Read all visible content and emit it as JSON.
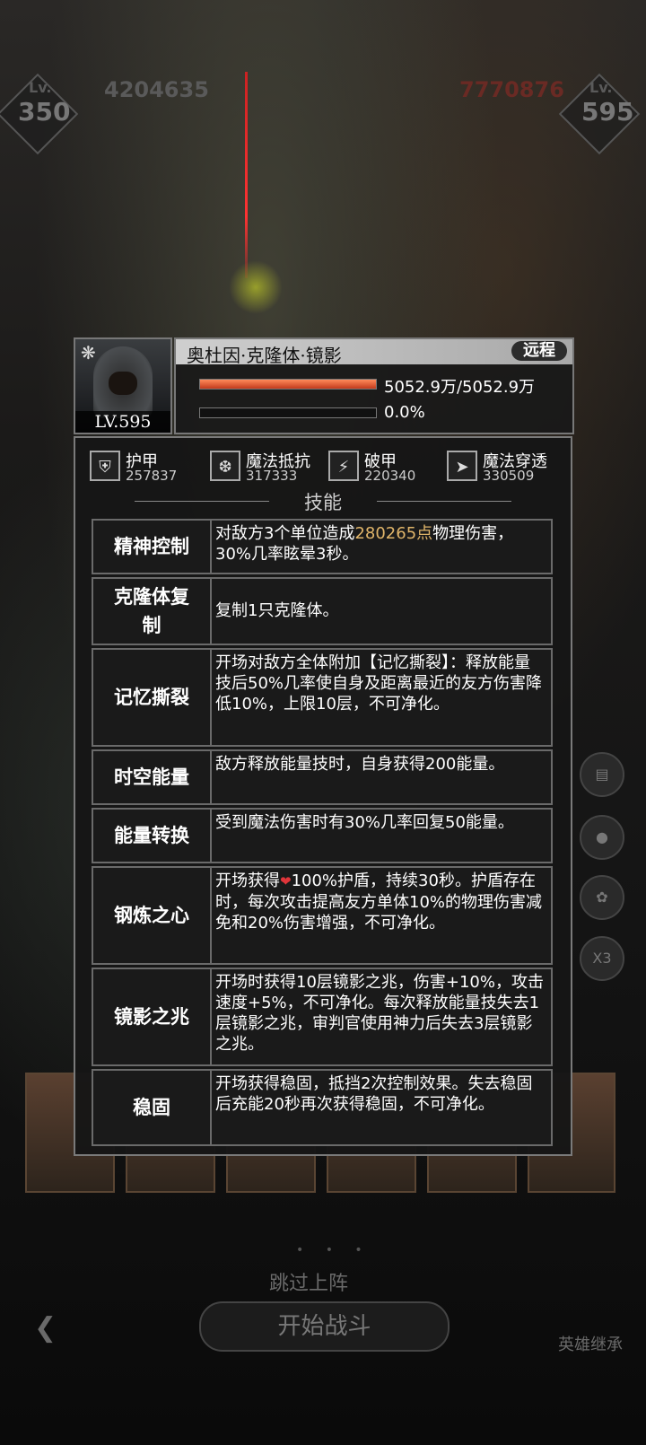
{
  "hud": {
    "left_lv_label": "Lv.",
    "left_lv": "350",
    "left_power": "4204635",
    "right_lv_label": "Lv.",
    "right_lv": "595",
    "right_power": "7770876"
  },
  "hero": {
    "name": "奥杜因·克隆体·镜影",
    "range_tag": "远程",
    "level": "LV.595",
    "hp_text": "5052.9万/5052.9万",
    "hp_fraction": 1.0,
    "energy_text": "0.0%",
    "energy_fraction": 0.0
  },
  "stats": [
    {
      "label": "护甲",
      "value": "257837",
      "icon": "armor-icon"
    },
    {
      "label": "魔法抵抗",
      "value": "317333",
      "icon": "magic-resist-icon"
    },
    {
      "label": "破甲",
      "value": "220340",
      "icon": "armor-break-icon"
    },
    {
      "label": "魔法穿透",
      "value": "330509",
      "icon": "magic-penetration-icon"
    }
  ],
  "section_title": "技能",
  "skills": [
    {
      "name": "精神控制",
      "desc_pre": "对敌方3个单位造成",
      "desc_hl": "280265点",
      "desc_post": "物理伤害，30%几率眩晕3秒。"
    },
    {
      "name": "克隆体复制",
      "desc": "复制1只克隆体。"
    },
    {
      "name": "记忆撕裂",
      "desc": "开场对敌方全体附加【记忆撕裂】：释放能量技后50%几率使自身及距离最近的友方伤害降低10%，上限10层，不可净化。"
    },
    {
      "name": "时空能量",
      "desc": "敌方释放能量技时，自身获得200能量。"
    },
    {
      "name": "能量转换",
      "desc": "受到魔法伤害时有30%几率回复50能量。"
    },
    {
      "name": "钢炼之心",
      "desc_pre": "开场获得",
      "desc_post": "100%护盾，持续30秒。护盾存在时，每次攻击提高友方单体10%的物理伤害减免和20%伤害增强，不可净化。"
    },
    {
      "name": "镜影之兆",
      "desc": "开场时获得10层镜影之兆，伤害+10%，攻击速度+5%，不可净化。每次释放能量技失去1层镜影之兆，审判官使用神力后失去3层镜影之兆。"
    },
    {
      "name": "稳固",
      "desc": "开场获得稳固，抵挡2次控制效果。失去稳固后充能20秒再次获得稳固，不可净化。"
    }
  ],
  "bottom": {
    "skip_label": "跳过上阵",
    "start_label": "开始战斗",
    "inherit_label": "英雄继承",
    "speed_label": "X3"
  }
}
